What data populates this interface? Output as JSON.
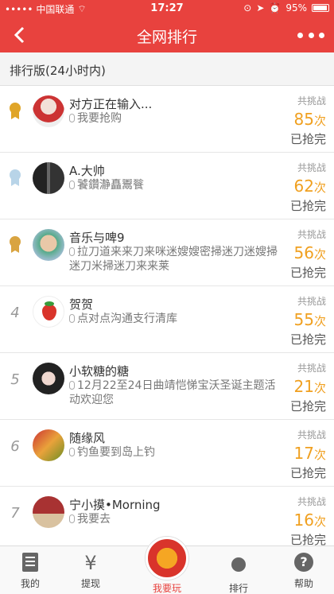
{
  "status_bar": {
    "carrier": "中国联通",
    "time": "17:27",
    "battery": "95%"
  },
  "header": {
    "title": "全网排行"
  },
  "section": {
    "title": "排行版(24小时内)"
  },
  "stats_label": "共挑战",
  "count_unit": "次",
  "rows": [
    {
      "rank": "1",
      "medal": "gold",
      "name": "对方正在输入...",
      "message": "我要抢购",
      "count": "85",
      "status": "已抢完"
    },
    {
      "rank": "2",
      "medal": "silver",
      "name": "A.大帅",
      "message": "饕鑽瀞矗鬻餮",
      "count": "62",
      "status": "已抢完"
    },
    {
      "rank": "3",
      "medal": "bronze",
      "name": "音乐与啤9",
      "message": "拉刀道来来刀来咪迷嫂嫂密掃迷刀迷嫂掃迷刀米掃迷刀来来莱",
      "count": "56",
      "status": "已抢完"
    },
    {
      "rank": "4",
      "medal": "",
      "name": "贺贺",
      "message": "点对点沟通支行清库",
      "count": "55",
      "status": "已抢完"
    },
    {
      "rank": "5",
      "medal": "",
      "name": "小软糖的糖",
      "message": "12月22至24日曲靖恺悌宝沃圣诞主题活动欢迎您",
      "count": "21",
      "status": "已抢完"
    },
    {
      "rank": "6",
      "medal": "",
      "name": "随缘风",
      "message": "钓鱼要到岛上钓",
      "count": "17",
      "status": "已抢完"
    },
    {
      "rank": "7",
      "medal": "",
      "name": "宁小摸•Morning",
      "message": "我要去",
      "count": "16",
      "status": "已抢完"
    }
  ],
  "tabs": {
    "mine": "我的",
    "withdraw": "提现",
    "play": "我要玩",
    "ranking": "排行",
    "help": "帮助"
  },
  "colors": {
    "brand_red": "#e8423e",
    "count_orange": "#f0a020",
    "gold": "#e0a528",
    "silver": "#b8d4e8",
    "bronze": "#d9a441"
  }
}
